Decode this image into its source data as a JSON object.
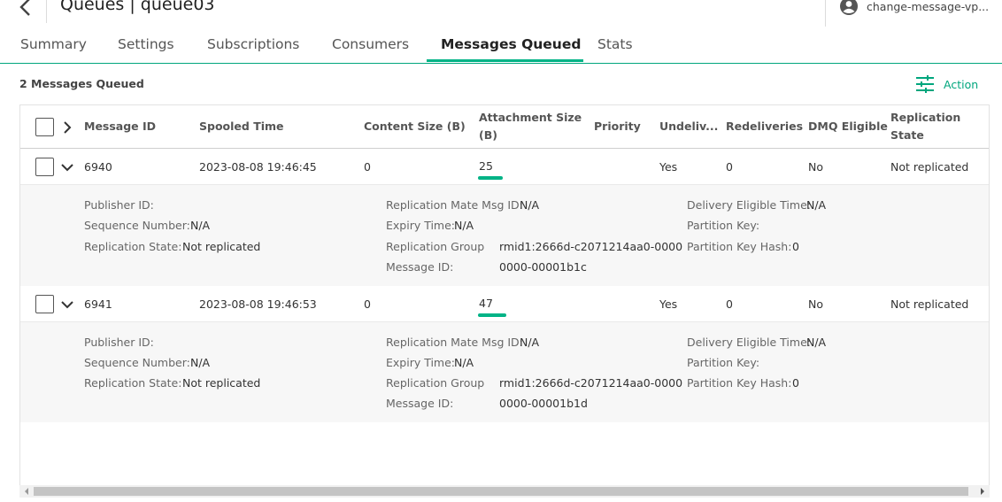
{
  "header": {
    "title": "Queues | queue03",
    "account_name": "change-message-vp..."
  },
  "tabs": [
    {
      "label": "Summary",
      "active": false
    },
    {
      "label": "Settings",
      "active": false
    },
    {
      "label": "Subscriptions",
      "active": false
    },
    {
      "label": "Consumers",
      "active": false
    },
    {
      "label": "Messages Queued",
      "active": true
    },
    {
      "label": "Stats",
      "active": false
    }
  ],
  "toolbar": {
    "count_label": "2 Messages Queued",
    "action_label": "Action"
  },
  "table": {
    "columns": {
      "message_id": "Message ID",
      "spooled_time": "Spooled Time",
      "content_size": "Content Size (B)",
      "attachment_size_1": "Attachment Size",
      "attachment_size_2": "(B)",
      "priority": "Priority",
      "undelivered": "Undeliv...",
      "redeliveries": "Redeliveries",
      "dmq_eligible": "DMQ Eligible",
      "replication_state_1": "Replication",
      "replication_state_2": "State"
    },
    "detail_labels": {
      "publisher_id": "Publisher ID:",
      "sequence_number": "Sequence Number:",
      "replication_state": "Replication State:",
      "replication_mate_msg_id": "Replication Mate Msg ID:",
      "expiry_time": "Expiry Time:",
      "replication_group_1": "Replication Group",
      "replication_group_2": "Message ID:",
      "delivery_eligible_time": "Delivery Eligible Time:",
      "partition_key": "Partition Key:",
      "partition_key_hash": "Partition Key Hash:"
    },
    "rows": [
      {
        "message_id": "6940",
        "spooled_time": "2023-08-08 19:46:45",
        "content_size": "0",
        "attachment_size": "25",
        "priority": "",
        "undelivered": "Yes",
        "redeliveries": "0",
        "dmq_eligible": "No",
        "replication_state": "Not replicated",
        "details": {
          "publisher_id": "",
          "sequence_number": "N/A",
          "replication_state": "Not replicated",
          "replication_mate_msg_id": "N/A",
          "expiry_time": "N/A",
          "replication_group_msg_id_1": "rmid1:2666d-c2071214aa0-0000",
          "replication_group_msg_id_2": "0000-00001b1c",
          "delivery_eligible_time": "N/A",
          "partition_key": "",
          "partition_key_hash": "0"
        }
      },
      {
        "message_id": "6941",
        "spooled_time": "2023-08-08 19:46:53",
        "content_size": "0",
        "attachment_size": "47",
        "priority": "",
        "undelivered": "Yes",
        "redeliveries": "0",
        "dmq_eligible": "No",
        "replication_state": "Not replicated",
        "details": {
          "publisher_id": "",
          "sequence_number": "N/A",
          "replication_state": "Not replicated",
          "replication_mate_msg_id": "N/A",
          "expiry_time": "N/A",
          "replication_group_msg_id_1": "rmid1:2666d-c2071214aa0-0000",
          "replication_group_msg_id_2": "0000-00001b1d",
          "delivery_eligible_time": "N/A",
          "partition_key": "",
          "partition_key_hash": "0"
        }
      }
    ]
  },
  "colors": {
    "accent": "#00b386",
    "accent_text": "#00a67d",
    "detail_bg": "#f7f7f7"
  },
  "icons": {
    "back": "chevron-left-icon",
    "account": "user-circle-icon",
    "action": "sliders-icon",
    "expand_all": "chevron-right-icon",
    "row_expanded": "chevron-down-icon"
  }
}
